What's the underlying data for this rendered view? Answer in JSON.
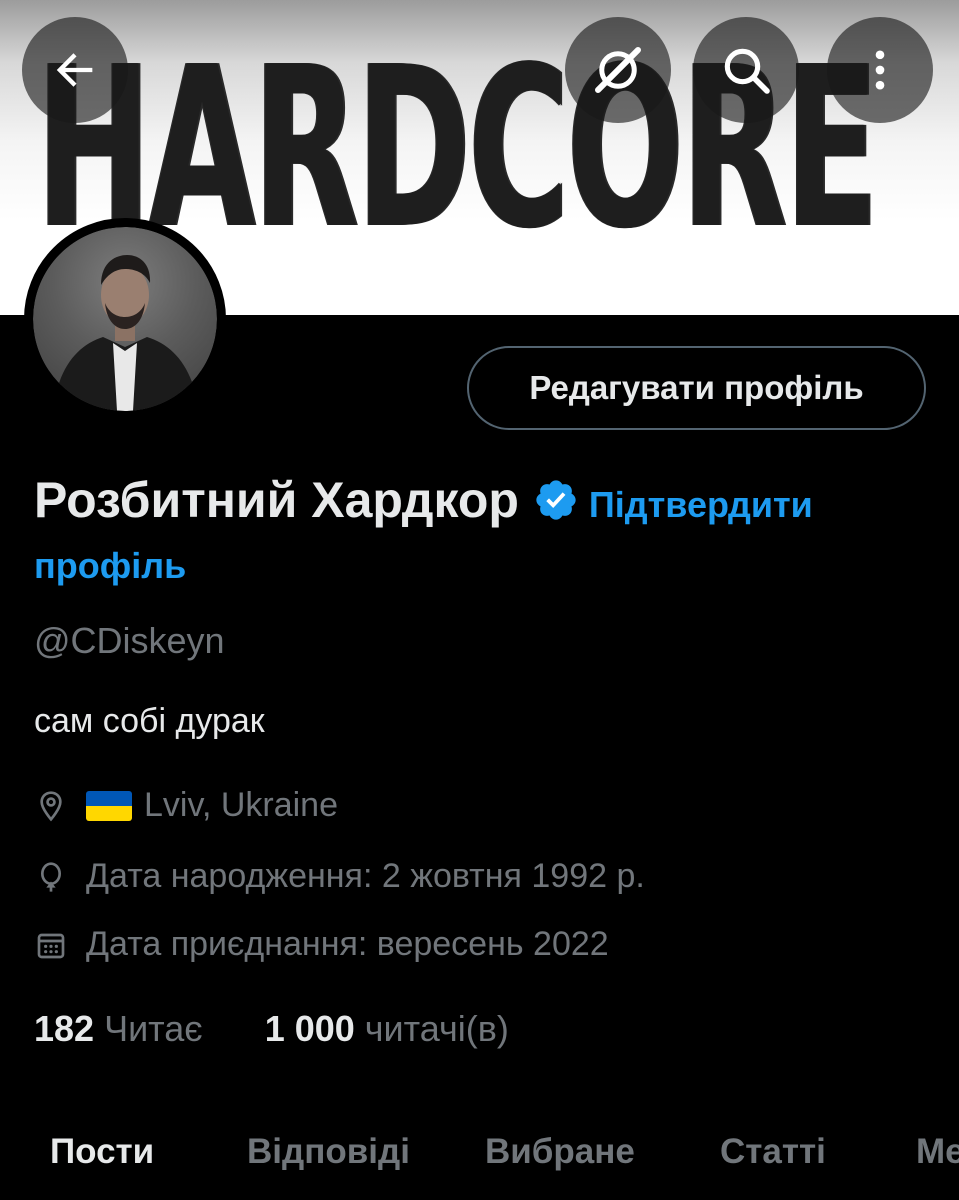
{
  "banner": {
    "text": "HARDCORE"
  },
  "nav": {
    "back_icon": "arrow-left-icon",
    "grok_icon": "grok-icon",
    "search_icon": "search-icon",
    "more_icon": "more-vertical-icon"
  },
  "profile": {
    "edit_label": "Редагувати профіль",
    "display_name": "Розбитний Хардкор",
    "verify_line1": "Підтвердити",
    "verify_line2": "профіль",
    "handle": "@CDiskeyn",
    "bio": "сам собі дурак",
    "location": "Lviv, Ukraine",
    "birth_date": "Дата народження: 2 жовтня 1992 р.",
    "joined": "Дата приєднання: вересень 2022",
    "following_count": "182",
    "following_label": "Читає",
    "followers_count": "1 000",
    "followers_label": "читачі(в)"
  },
  "tabs": [
    {
      "label": "Пости",
      "active": true
    },
    {
      "label": "Відповіді"
    },
    {
      "label": "Вибране"
    },
    {
      "label": "Статті"
    },
    {
      "label": "Медіа"
    }
  ],
  "colors": {
    "background": "#000000",
    "accent": "#1d9bf0",
    "text_primary": "#e7e9ea",
    "text_secondary": "#71767b",
    "border": "#536471"
  }
}
